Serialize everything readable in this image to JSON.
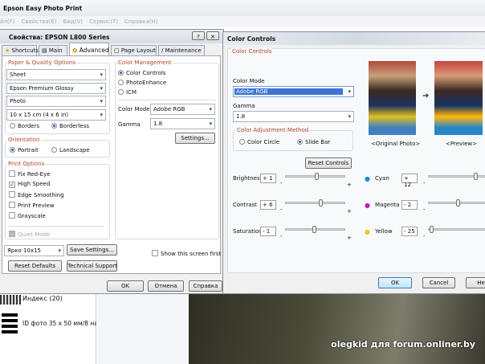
{
  "app": {
    "title": "Epson Easy Photo Print",
    "menu": [
      "йл(F)",
      "Свойства(E)",
      "Вид(V)",
      "Сервис(T)",
      "Справка(H)"
    ]
  },
  "props": {
    "title": "Свойства: EPSON L800 Series",
    "tabs": [
      "Shortcuts",
      "Main",
      "Advanced",
      "Page Layout",
      "Maintenance"
    ],
    "active_tab": "Advanced",
    "paper_group": "Paper & Quality Options",
    "paper_source": "Sheet",
    "paper_type": "Epson Premium Glossy",
    "quality": "Photo",
    "size": "10 x 15 cm (4 x 6 in)",
    "borders": "Borders",
    "borderless": "Borderless",
    "orientation_group": "Orientation",
    "portrait": "Portrait",
    "landscape": "Landscape",
    "print_options_group": "Print Options",
    "options": [
      {
        "label": "Fix Red-Eye",
        "checked": false
      },
      {
        "label": "High Speed",
        "checked": true
      },
      {
        "label": "Edge Smoothing",
        "checked": false
      },
      {
        "label": "Print Preview",
        "checked": false
      },
      {
        "label": "Grayscale",
        "checked": false
      }
    ],
    "quiet_mode": "Quiet Mode",
    "cm_group": "Color Management",
    "cm_options": [
      "Color Controls",
      "PhotoEnhance",
      "ICM"
    ],
    "color_mode_label": "Color Mode",
    "color_mode": "Adobe RGB",
    "gamma_label": "Gamma",
    "gamma": "1.8",
    "settings": "Settings...",
    "preset": "Ярко 10x15",
    "save_settings": "Save Settings...",
    "reset_defaults": "Reset Defaults",
    "tech_support": "Technical Support",
    "show_first": "Show this screen first",
    "ok": "OK",
    "cancel": "Отмена",
    "help": "Справка"
  },
  "cc": {
    "title": "Color Controls",
    "group": "Color Controls",
    "color_mode_label": "Color Mode",
    "color_mode": "Adobe RGB",
    "gamma_label": "Gamma",
    "gamma": "1.8",
    "method_group": "Color Adjustment Method",
    "color_circle": "Color Circle",
    "slide_bar": "Slide Bar",
    "reset": "Reset Controls",
    "original": "<Original Photo>",
    "preview": "<Preview>",
    "sliders_left": [
      {
        "label": "Brightness",
        "value": "+ 1",
        "pos": 0.52
      },
      {
        "label": "Contrast",
        "value": "+ 6",
        "pos": 0.6
      },
      {
        "label": "Saturation",
        "value": "- 1",
        "pos": 0.48
      }
    ],
    "sliders_right": [
      {
        "label": "Cyan",
        "value": "+ 12",
        "pos": 0.75,
        "color": "#1b8fd0"
      },
      {
        "label": "Magenta",
        "value": "- 2",
        "pos": 0.46,
        "color": "#c020b0"
      },
      {
        "label": "Yellow",
        "value": "- 25",
        "pos": 0.02,
        "color": "#e8c820"
      }
    ],
    "ok": "OK",
    "cancel": "Cancel",
    "help": "Hel"
  },
  "background": {
    "items": [
      "Индекс (20)",
      "ID фото 35 x 50 мм/8 на л"
    ],
    "watermark": "olegkid для forum.onliner.by"
  }
}
